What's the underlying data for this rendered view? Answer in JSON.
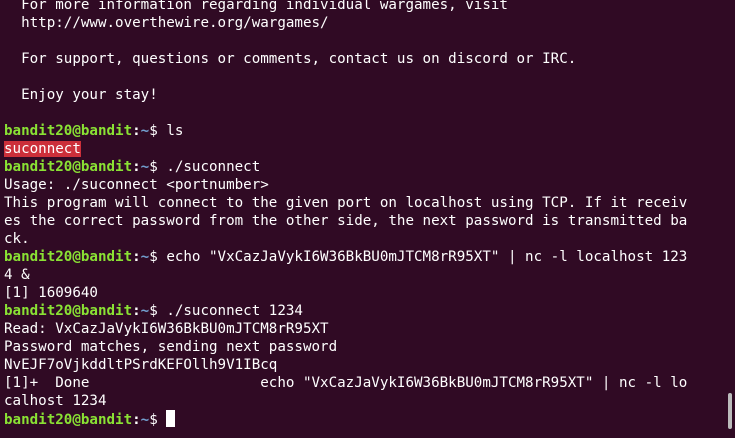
{
  "terminal": {
    "lines": [
      {
        "type": "text",
        "text": "  For more information regarding individual wargames, visit"
      },
      {
        "type": "text",
        "text": "  http://www.overthewire.org/wargames/"
      },
      {
        "type": "text",
        "text": ""
      },
      {
        "type": "text",
        "text": "  For support, questions or comments, contact us on discord or IRC."
      },
      {
        "type": "text",
        "text": ""
      },
      {
        "type": "text",
        "text": "  Enjoy your stay!"
      },
      {
        "type": "text",
        "text": ""
      },
      {
        "type": "prompt",
        "user": "bandit20@bandit",
        "sep": ":",
        "path": "~",
        "symbol": "$ ",
        "command": "ls"
      },
      {
        "type": "exec",
        "text": "suconnect"
      },
      {
        "type": "prompt",
        "user": "bandit20@bandit",
        "sep": ":",
        "path": "~",
        "symbol": "$ ",
        "command": "./suconnect"
      },
      {
        "type": "text",
        "text": "Usage: ./suconnect <portnumber>"
      },
      {
        "type": "text",
        "text": "This program will connect to the given port on localhost using TCP. If it receiv"
      },
      {
        "type": "text",
        "text": "es the correct password from the other side, the next password is transmitted ba"
      },
      {
        "type": "text",
        "text": "ck."
      },
      {
        "type": "prompt",
        "user": "bandit20@bandit",
        "sep": ":",
        "path": "~",
        "symbol": "$ ",
        "command": "echo \"VxCazJaVykI6W36BkBU0mJTCM8rR95XT\" | nc -l localhost 123"
      },
      {
        "type": "text",
        "text": "4 &"
      },
      {
        "type": "text",
        "text": "[1] 1609640"
      },
      {
        "type": "prompt",
        "user": "bandit20@bandit",
        "sep": ":",
        "path": "~",
        "symbol": "$ ",
        "command": "./suconnect 1234"
      },
      {
        "type": "text",
        "text": "Read: VxCazJaVykI6W36BkBU0mJTCM8rR95XT"
      },
      {
        "type": "text",
        "text": "Password matches, sending next password"
      },
      {
        "type": "text",
        "text": "NvEJF7oVjkddltPSrdKEFOllh9V1IBcq"
      },
      {
        "type": "text",
        "text": "[1]+  Done                    echo \"VxCazJaVykI6W36BkBU0mJTCM8rR95XT\" | nc -l lo"
      },
      {
        "type": "text",
        "text": "calhost 1234"
      },
      {
        "type": "prompt",
        "user": "bandit20@bandit",
        "sep": ":",
        "path": "~",
        "symbol": "$ ",
        "command": "",
        "cursor": true
      }
    ]
  },
  "colors": {
    "background": "#300a24",
    "prompt_user": "#8ae234",
    "prompt_path": "#729fcf",
    "exec_highlight": "#cc2f3a",
    "text": "#ffffff"
  }
}
